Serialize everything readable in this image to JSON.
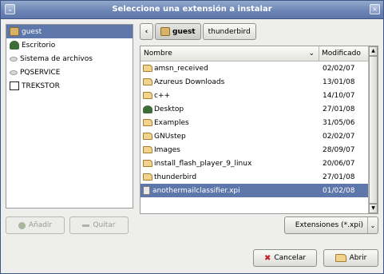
{
  "window": {
    "title": "Seleccione una extensión a instalar",
    "menu_glyph": "⌄",
    "close_glyph": "×"
  },
  "places": [
    {
      "label": "guest",
      "icon": "home-folder-icon",
      "selected": true
    },
    {
      "label": "Escritorio",
      "icon": "desktop-icon",
      "selected": false
    },
    {
      "label": "Sistema de archivos",
      "icon": "filesystem-icon",
      "selected": false
    },
    {
      "label": "PQSERVICE",
      "icon": "disk-icon",
      "selected": false
    },
    {
      "label": "TREKSTOR",
      "icon": "usb-drive-icon",
      "selected": false
    }
  ],
  "pathbar": {
    "back_glyph": "‹",
    "crumbs": [
      "guest",
      "thunderbird"
    ]
  },
  "filelist": {
    "col_name": "Nombre",
    "col_date": "Modificado",
    "sort_glyph": "⌄",
    "rows": [
      {
        "name": "amsn_received",
        "date": "02/02/07",
        "icon": "folder-icon"
      },
      {
        "name": "Azureus Downloads",
        "date": "13/01/08",
        "icon": "folder-icon"
      },
      {
        "name": "c++",
        "date": "14/10/07",
        "icon": "folder-icon"
      },
      {
        "name": "Desktop",
        "date": "27/01/08",
        "icon": "desktop-folder-icon"
      },
      {
        "name": "Examples",
        "date": "31/05/06",
        "icon": "folder-icon"
      },
      {
        "name": "GNUstep",
        "date": "02/02/07",
        "icon": "folder-icon"
      },
      {
        "name": "Images",
        "date": "28/09/07",
        "icon": "folder-icon"
      },
      {
        "name": "install_flash_player_9_linux",
        "date": "20/06/07",
        "icon": "folder-icon"
      },
      {
        "name": "thunderbird",
        "date": "27/01/08",
        "icon": "folder-icon"
      },
      {
        "name": "anothermailclassifier.xpi",
        "date": "01/02/08",
        "icon": "xpi-file-icon",
        "selected": true
      }
    ]
  },
  "buttons": {
    "add": "Añadir",
    "remove": "Quitar",
    "cancel": "Cancelar",
    "open": "Abrir"
  },
  "filter": {
    "value": "Extensiones (*.xpi)",
    "arrow_glyph": "⌄"
  },
  "colors": {
    "selection": "#5d77aa",
    "titlebar": "#6d86b6"
  }
}
